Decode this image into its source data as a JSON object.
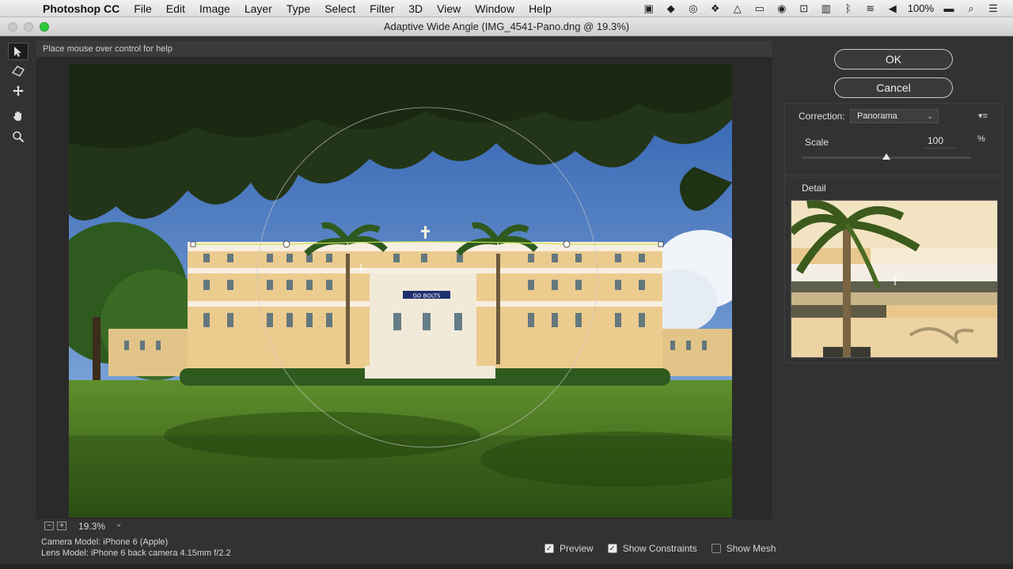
{
  "menubar": {
    "app_name": "Photoshop CC",
    "items": [
      "File",
      "Edit",
      "Image",
      "Layer",
      "Type",
      "Select",
      "Filter",
      "3D",
      "View",
      "Window",
      "Help"
    ],
    "battery": "100%"
  },
  "window": {
    "title": "Adaptive Wide Angle (IMG_4541-Pano.dng @ 19.3%)"
  },
  "help_text": "Place mouse over control for help",
  "zoom": {
    "value": "19.3%",
    "minus": "−",
    "plus": "+"
  },
  "info": {
    "camera_model": "Camera Model: iPhone 6 (Apple)",
    "lens_model": "Lens Model: iPhone 6 back camera 4.15mm f/2.2"
  },
  "options": {
    "preview_label": "Preview",
    "preview_checked": true,
    "constraints_label": "Show Constraints",
    "constraints_checked": true,
    "mesh_label": "Show Mesh",
    "mesh_checked": false
  },
  "panel": {
    "ok_label": "OK",
    "cancel_label": "Cancel",
    "correction_label": "Correction:",
    "correction_value": "Panorama",
    "scale_label": "Scale",
    "scale_value": "100",
    "scale_unit": "%",
    "scale_level": 0.5,
    "detail_label": "Detail"
  },
  "image": {
    "banner_text": "GO BOLTS"
  }
}
